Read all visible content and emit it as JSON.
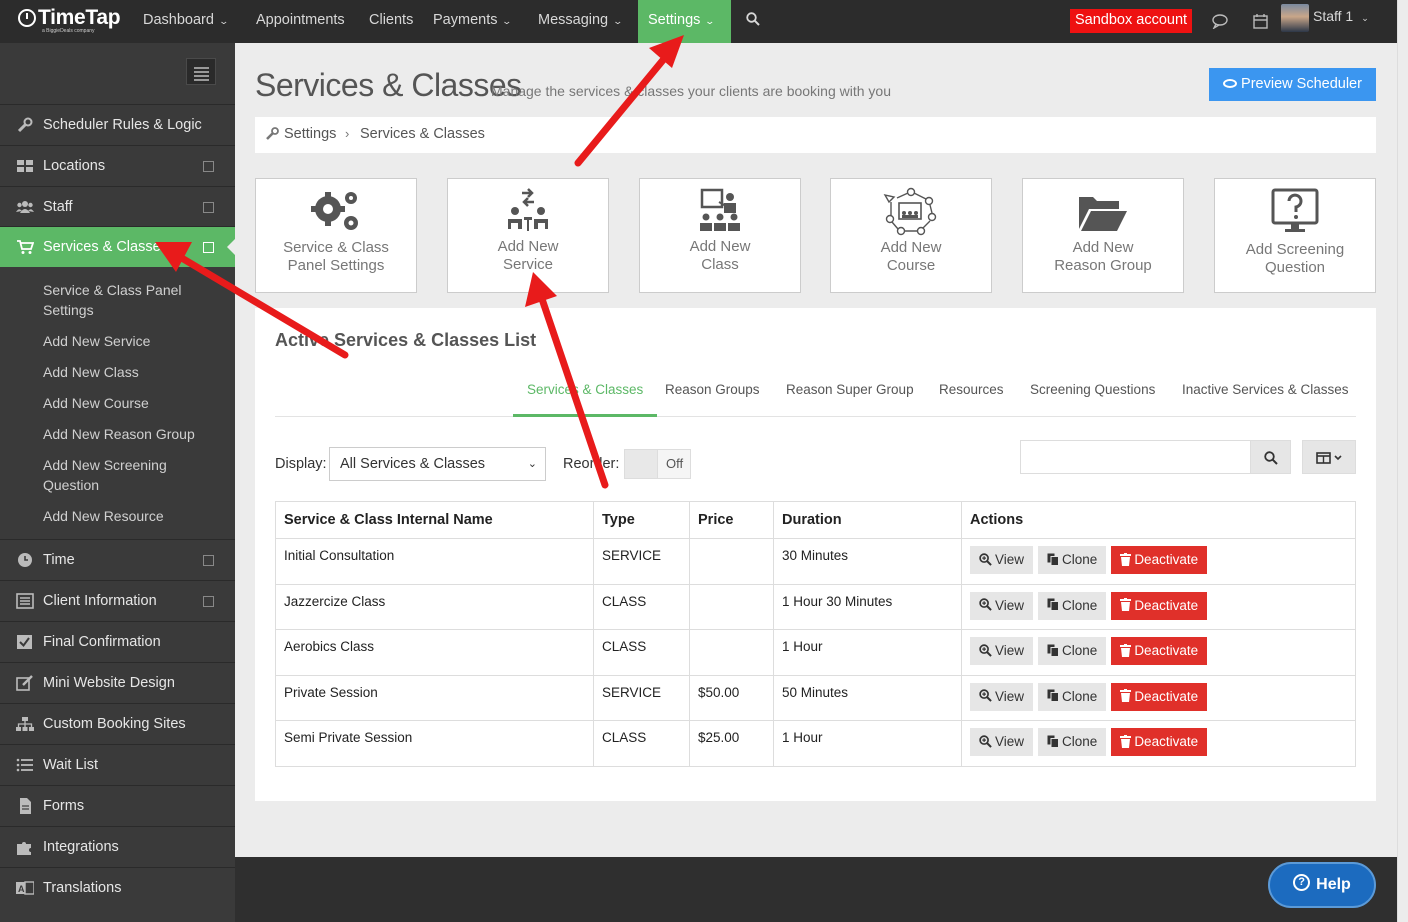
{
  "topnav": {
    "logo": "TimeTap",
    "logo_sub": "a BiggieDeals company",
    "items": [
      "Dashboard",
      "Appointments",
      "Clients",
      "Payments",
      "Messaging",
      "Settings"
    ],
    "sandbox": "Sandbox account",
    "user": "Staff 1"
  },
  "sidebar": {
    "items": [
      "Scheduler Rules & Logic",
      "Locations",
      "Staff",
      "Services & Classes",
      "Time",
      "Client Information",
      "Final Confirmation",
      "Mini Website Design",
      "Custom Booking Sites",
      "Wait List",
      "Forms",
      "Integrations",
      "Translations"
    ],
    "sub_items": [
      "Service & Class Panel Settings",
      "Add New Service",
      "Add New Class",
      "Add New Course",
      "Add New Reason Group",
      "Add New Screening Question",
      "Add New Resource"
    ]
  },
  "page": {
    "title": "Services & Classes",
    "subtitle": "Manage the services & classes your clients are booking with you",
    "preview_button": "Preview Scheduler",
    "breadcrumb": [
      "Settings",
      "Services & Classes"
    ]
  },
  "tiles": [
    {
      "line1": "Service & Class",
      "line2": "Panel Settings",
      "icon": "gears-icon"
    },
    {
      "line1": "Add New",
      "line2": "Service",
      "icon": "meeting-icon"
    },
    {
      "line1": "Add New",
      "line2": "Class",
      "icon": "classroom-icon"
    },
    {
      "line1": "Add New",
      "line2": "Course",
      "icon": "network-icon"
    },
    {
      "line1": "Add New",
      "line2": "Reason Group",
      "icon": "folder-icon"
    },
    {
      "line1": "Add Screening",
      "line2": "Question",
      "icon": "monitor-question-icon"
    }
  ],
  "list": {
    "title": "Active Services & Classes List",
    "tabs": [
      "Services & Classes",
      "Reason Groups",
      "Reason Super Group",
      "Resources",
      "Screening Questions",
      "Inactive Services & Classes"
    ],
    "display_label": "Display:",
    "display_value": "All Services & Classes",
    "reorder_label": "Reorder:",
    "toggle_off": "Off",
    "columns": [
      "Service & Class Internal Name",
      "Type",
      "Price",
      "Duration",
      "Actions"
    ],
    "rows": [
      {
        "name": "Initial Consultation",
        "type": "SERVICE",
        "price": "",
        "duration": "30 Minutes"
      },
      {
        "name": "Jazzercize Class",
        "type": "CLASS",
        "price": "",
        "duration": "1 Hour 30 Minutes"
      },
      {
        "name": "Aerobics Class",
        "type": "CLASS",
        "price": "",
        "duration": "1 Hour"
      },
      {
        "name": "Private Session",
        "type": "SERVICE",
        "price": "$50.00",
        "duration": "50 Minutes"
      },
      {
        "name": "Semi Private Session",
        "type": "CLASS",
        "price": "$25.00",
        "duration": "1 Hour"
      }
    ],
    "actions": {
      "view": "View",
      "clone": "Clone",
      "deactivate": "Deactivate"
    }
  },
  "help": "Help",
  "colors": {
    "accent_green": "#5cb866",
    "primary_blue": "#3b96f0",
    "danger_red": "#e0302a",
    "annotation_red": "#e81b1b"
  }
}
